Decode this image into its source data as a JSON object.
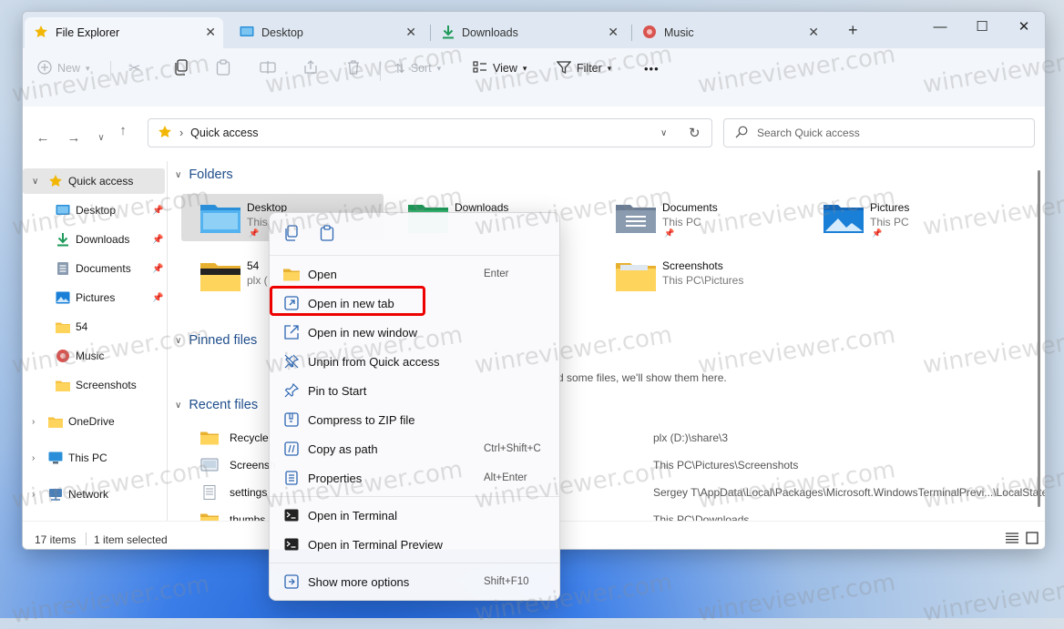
{
  "window": {
    "tabs": [
      {
        "label": "File Explorer",
        "icon": "star-icon"
      },
      {
        "label": "Desktop",
        "icon": "desktop-icon"
      },
      {
        "label": "Downloads",
        "icon": "download-icon"
      },
      {
        "label": "Music",
        "icon": "music-icon"
      }
    ],
    "new_tab": "+",
    "controls": {
      "minimize": "—",
      "maximize": "☐",
      "close": "✕"
    }
  },
  "toolbar": {
    "new_label": "New",
    "sort_label": "Sort",
    "view_label": "View",
    "filter_label": "Filter",
    "more_label": "•••"
  },
  "address": {
    "path": "Quick access",
    "search_placeholder": "Search Quick access"
  },
  "sidebar": {
    "quick_access": "Quick access",
    "items": [
      {
        "label": "Desktop",
        "icon": "desktop-icon",
        "pinned": true
      },
      {
        "label": "Downloads",
        "icon": "download-icon",
        "pinned": true
      },
      {
        "label": "Documents",
        "icon": "documents-icon",
        "pinned": true
      },
      {
        "label": "Pictures",
        "icon": "pictures-icon",
        "pinned": true
      },
      {
        "label": "54",
        "icon": "folder-icon",
        "pinned": false
      },
      {
        "label": "Music",
        "icon": "music-icon",
        "pinned": false
      },
      {
        "label": "Screenshots",
        "icon": "folder-icon",
        "pinned": false
      }
    ],
    "onedrive": "OneDrive",
    "thispc": "This PC",
    "network": "Network"
  },
  "content": {
    "folders_header": "Folders",
    "folders": [
      {
        "name": "Desktop",
        "sub": "This PC",
        "pinned": true
      },
      {
        "name": "Downloads",
        "sub": "",
        "pinned": false
      },
      {
        "name": "Documents",
        "sub": "This PC",
        "pinned": true
      },
      {
        "name": "Pictures",
        "sub": "This PC",
        "pinned": true
      },
      {
        "name": "54",
        "sub": "plx (",
        "pinned": false
      },
      {
        "name": "Screenshots",
        "sub": "This PC\\Pictures",
        "pinned": false
      }
    ],
    "pinned_header": "Pinned files",
    "pinned_empty": "d some files, we'll show them here.",
    "recent_header": "Recent files",
    "recent": [
      {
        "name": "Recycle",
        "path": "plx (D:)\\share\\3"
      },
      {
        "name": "Screensh",
        "path": "This PC\\Pictures\\Screenshots"
      },
      {
        "name": "settings",
        "path": "Sergey T\\AppData\\Local\\Packages\\Microsoft.WindowsTerminalPrevi...\\LocalState"
      },
      {
        "name": "thumbs_",
        "path": "This PC\\Downloads"
      }
    ]
  },
  "status": {
    "items": "17 items",
    "selected": "1 item selected"
  },
  "context_menu": {
    "items": [
      {
        "label": "Open",
        "key": "Enter",
        "icon": "open-icon"
      },
      {
        "label": "Open in new tab",
        "key": "",
        "icon": "new-tab-icon"
      },
      {
        "label": "Open in new window",
        "key": "",
        "icon": "new-window-icon"
      },
      {
        "label": "Unpin from Quick access",
        "key": "",
        "icon": "unpin-icon"
      },
      {
        "label": "Pin to Start",
        "key": "",
        "icon": "pin-icon"
      },
      {
        "label": "Compress to ZIP file",
        "key": "",
        "icon": "zip-icon"
      },
      {
        "label": "Copy as path",
        "key": "Ctrl+Shift+C",
        "icon": "copy-path-icon"
      },
      {
        "label": "Properties",
        "key": "Alt+Enter",
        "icon": "properties-icon"
      },
      {
        "label": "Open in Terminal",
        "key": "",
        "icon": "terminal-icon"
      },
      {
        "label": "Open in Terminal Preview",
        "key": "",
        "icon": "terminal-icon"
      },
      {
        "label": "Show more options",
        "key": "Shift+F10",
        "icon": "more-options-icon"
      }
    ]
  },
  "watermark": "winreviewer.com",
  "colors": {
    "accent": "#1f4e8c",
    "highlight_border": "#e00000",
    "folder_yellow": "#f5c242"
  }
}
